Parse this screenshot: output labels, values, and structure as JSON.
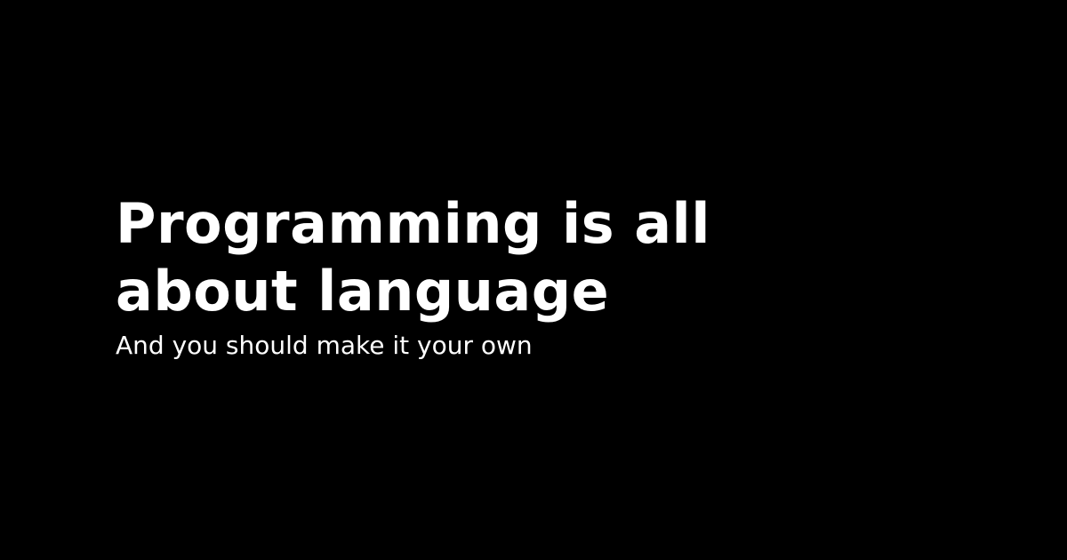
{
  "card": {
    "title_line_1": "Programming is all",
    "title_line_2": "about language",
    "subtitle": "And you should make it your own",
    "colors": {
      "background": "#000000",
      "text": "#ffffff"
    }
  }
}
